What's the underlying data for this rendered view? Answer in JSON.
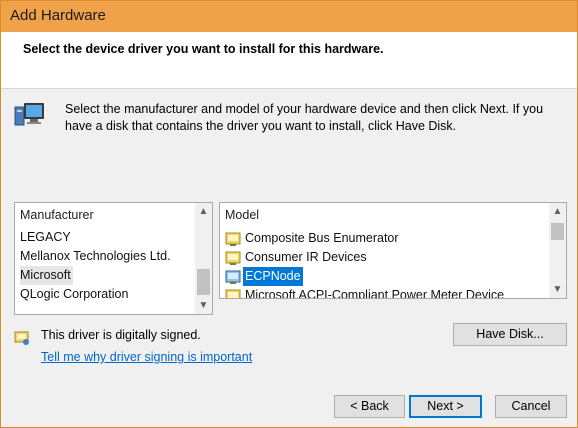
{
  "window": {
    "title": "Add Hardware"
  },
  "header": {
    "heading": "Select the device driver you want to install for this hardware."
  },
  "info": {
    "icon": "hardware-computer-icon",
    "line1": "Select the manufacturer and model of your hardware device and then click Next. If you",
    "line2": "have a disk that contains the driver you want to install, click Have Disk."
  },
  "manufacturer_list": {
    "header": "Manufacturer",
    "items": [
      {
        "label": "LEGACY"
      },
      {
        "label": "Mellanox Technologies Ltd."
      },
      {
        "label": "Microsoft",
        "selected": true
      },
      {
        "label": "QLogic Corporation"
      }
    ]
  },
  "model_list": {
    "header": "Model",
    "items": [
      {
        "label": "Composite Bus Enumerator",
        "icon": "driver-icon"
      },
      {
        "label": "Consumer IR Devices",
        "icon": "driver-icon"
      },
      {
        "label": "ECPNode",
        "icon": "driver-icon",
        "selected": true
      },
      {
        "label": "Microsoft ACPI-Compliant Power Meter Device",
        "icon": "driver-icon"
      }
    ]
  },
  "signature": {
    "status": "This driver is digitally signed.",
    "link": "Tell me why driver signing is important"
  },
  "buttons": {
    "have_disk": "Have Disk...",
    "back": "< Back",
    "next": "Next >",
    "cancel": "Cancel"
  },
  "colors": {
    "titlebar": "#f0a24a",
    "selection": "#0078d7",
    "link": "#0066cc"
  }
}
